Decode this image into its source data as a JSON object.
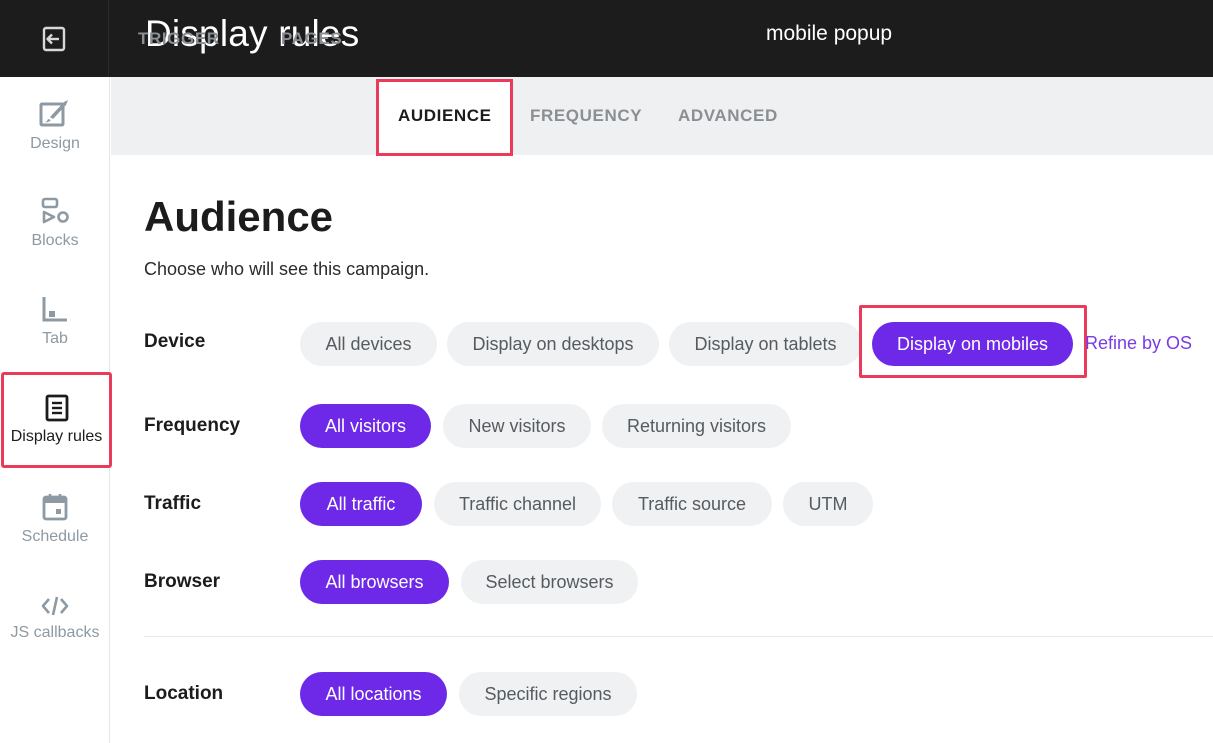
{
  "header": {
    "title": "Display rules",
    "campaign": "mobile popup"
  },
  "sidebar": {
    "items": [
      {
        "label": "Design",
        "icon": "design-icon"
      },
      {
        "label": "Blocks",
        "icon": "blocks-icon"
      },
      {
        "label": "Tab",
        "icon": "tab-icon"
      },
      {
        "label": "Display rules",
        "icon": "display-rules-icon",
        "active": true
      },
      {
        "label": "Schedule",
        "icon": "calendar-icon"
      },
      {
        "label": "JS callbacks",
        "icon": "code-icon"
      }
    ]
  },
  "tabs": [
    {
      "label": "TRIGGER"
    },
    {
      "label": "PAGES"
    },
    {
      "label": "AUDIENCE",
      "active": true
    },
    {
      "label": "FREQUENCY"
    },
    {
      "label": "ADVANCED"
    }
  ],
  "audience": {
    "title": "Audience",
    "description": "Choose who will see this campaign.",
    "rows": {
      "device": {
        "label": "Device",
        "options": [
          "All devices",
          "Display on desktops",
          "Display on tablets",
          "Display on mobiles"
        ],
        "selected": "Display on mobiles",
        "link": "Refine by OS"
      },
      "frequency": {
        "label": "Frequency",
        "options": [
          "All visitors",
          "New visitors",
          "Returning visitors"
        ],
        "selected": "All visitors"
      },
      "traffic": {
        "label": "Traffic",
        "options": [
          "All traffic",
          "Traffic channel",
          "Traffic source",
          "UTM"
        ],
        "selected": "All traffic"
      },
      "browser": {
        "label": "Browser",
        "options": [
          "All browsers",
          "Select browsers"
        ],
        "selected": "All browsers"
      },
      "location": {
        "label": "Location",
        "options": [
          "All locations",
          "Specific regions"
        ],
        "selected": "All locations"
      }
    }
  },
  "colors": {
    "accent": "#6d28e8",
    "highlight": "#ea3b5b",
    "header_bg": "#1c1c1c"
  }
}
